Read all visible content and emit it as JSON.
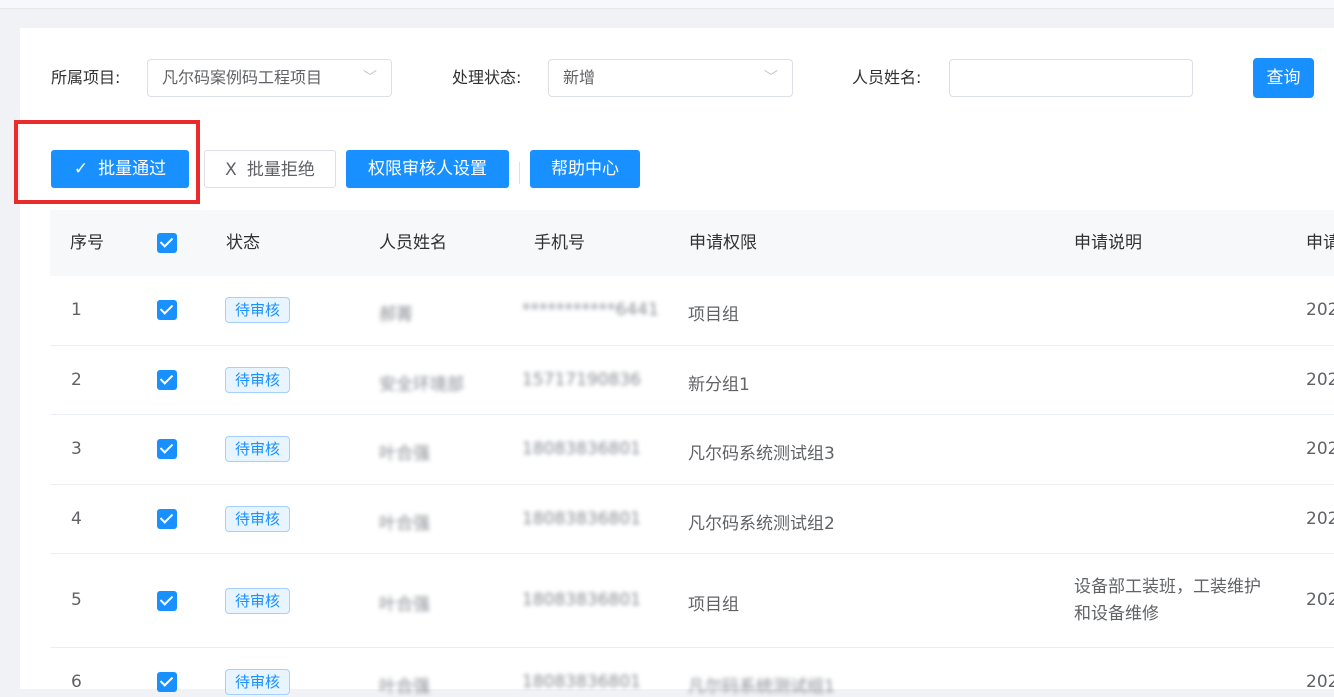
{
  "filters": {
    "project_label": "所属项目:",
    "project_value": "凡尔码案例码工程项目",
    "status_label": "处理状态:",
    "status_value": "新增",
    "name_label": "人员姓名:",
    "name_value": "",
    "query_label": "查询"
  },
  "toolbar": {
    "approve_icon": "✓",
    "approve_label": "批量通过",
    "reject_icon": "X",
    "reject_label": "批量拒绝",
    "reviewer_label": "权限审核人设置",
    "help_label": "帮助中心"
  },
  "table": {
    "headers": {
      "index": "序号",
      "status": "状态",
      "name": "人员姓名",
      "phone": "手机号",
      "permission": "申请权限",
      "description": "申请说明",
      "time": "申请"
    },
    "rows": [
      {
        "index": "1",
        "status": "待审核",
        "name": "郝菁",
        "phone": "***********6441",
        "permission": "项目组",
        "description": "",
        "time": "202"
      },
      {
        "index": "2",
        "status": "待审核",
        "name": "安全环境部",
        "phone": "15717190836",
        "permission": "新分组1",
        "description": "",
        "time": "202"
      },
      {
        "index": "3",
        "status": "待审核",
        "name": "叶合强",
        "phone": "18083836801",
        "permission": "凡尔码系统测试组3",
        "description": "",
        "time": "202"
      },
      {
        "index": "4",
        "status": "待审核",
        "name": "叶合强",
        "phone": "18083836801",
        "permission": "凡尔码系统测试组2",
        "description": "",
        "time": "202"
      },
      {
        "index": "5",
        "status": "待审核",
        "name": "叶合强",
        "phone": "18083836801",
        "permission": "项目组",
        "description": "设备部工装班，工装维护和设备维修",
        "time": "202"
      },
      {
        "index": "6",
        "status": "待审核",
        "name": "叶合强",
        "phone": "18083836801",
        "permission": "凡尔码系统测试组1",
        "description": "",
        "time": "202"
      }
    ]
  },
  "colors": {
    "primary": "#1890ff",
    "highlight": "#ea2b2b"
  }
}
